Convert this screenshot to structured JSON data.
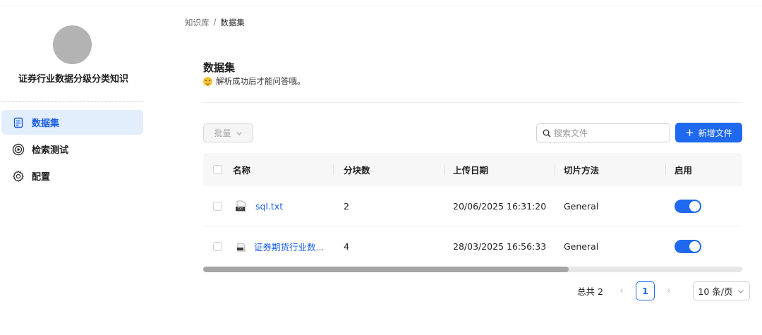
{
  "sidebar": {
    "kb_name": "证券行业数据分级分类知识",
    "items": [
      {
        "label": "数据集",
        "icon": "document-icon",
        "active": true
      },
      {
        "label": "检索测试",
        "icon": "target-icon",
        "active": false
      },
      {
        "label": "配置",
        "icon": "gear-icon",
        "active": false
      }
    ]
  },
  "breadcrumb": {
    "root": "知识库",
    "separator": "/",
    "current": "数据集"
  },
  "header": {
    "title": "数据集",
    "tip": "解析成功后才能问答哦。"
  },
  "toolbar": {
    "batch_label": "批量",
    "search_placeholder": "搜索文件",
    "add_label": "新增文件"
  },
  "table": {
    "columns": [
      "名称",
      "分块数",
      "上传日期",
      "切片方法",
      "启用"
    ],
    "rows": [
      {
        "name": "sql.txt",
        "chunks": "2",
        "date": "20/06/2025 16:31:20",
        "method": "General",
        "enabled": true
      },
      {
        "name": "证券期货行业数...",
        "chunks": "4",
        "date": "28/03/2025 16:56:33",
        "method": "General",
        "enabled": true
      }
    ]
  },
  "pagination": {
    "total": "总共 2",
    "current_page": "1",
    "page_size": "10 条/页"
  },
  "colors": {
    "accent": "#1f69f0",
    "active_bg": "#e3eefc",
    "link": "#1a5ee6"
  }
}
